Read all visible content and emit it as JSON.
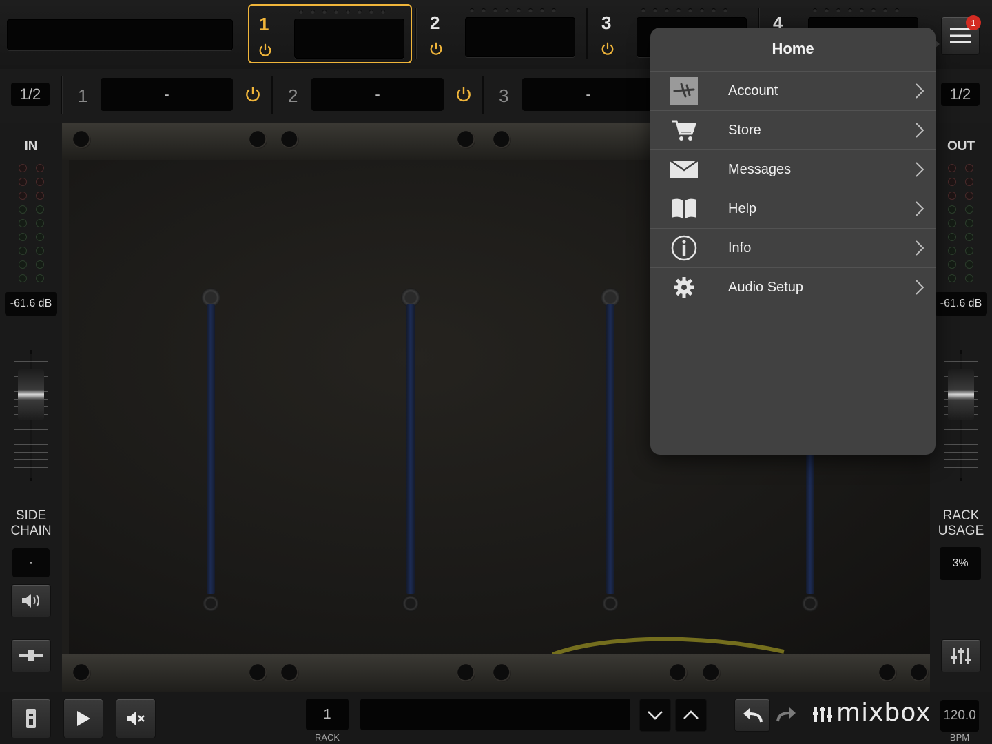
{
  "top_slots": [
    {
      "num": "1",
      "active": true
    },
    {
      "num": "2",
      "active": false
    },
    {
      "num": "3",
      "active": false
    },
    {
      "num": "4",
      "active": false
    }
  ],
  "channel_bar": {
    "page_left": "1/2",
    "page_right": "1/2",
    "channels": [
      {
        "num": "1",
        "value": "-"
      },
      {
        "num": "2",
        "value": "-"
      },
      {
        "num": "3",
        "value": "-"
      }
    ]
  },
  "input_panel": {
    "label": "IN",
    "level": "-61.6 dB",
    "side_chain_line1": "SIDE",
    "side_chain_line2": "CHAIN",
    "side_chain_value": "-"
  },
  "output_panel": {
    "label": "OUT",
    "level": "-61.6 dB",
    "rack_usage_line1": "RACK",
    "rack_usage_line2": "USAGE",
    "rack_usage_value": "3%"
  },
  "menu_button": {
    "badge": "1"
  },
  "home_menu": {
    "title": "Home",
    "items": [
      {
        "label": "Account",
        "icon": "account-icon"
      },
      {
        "label": "Store",
        "icon": "cart-icon"
      },
      {
        "label": "Messages",
        "icon": "envelope-icon"
      },
      {
        "label": "Help",
        "icon": "book-icon"
      },
      {
        "label": "Info",
        "icon": "info-icon"
      },
      {
        "label": "Audio Setup",
        "icon": "gear-icon"
      }
    ]
  },
  "bottom_bar": {
    "rack_number": "1",
    "rack_label": "RACK",
    "preset_name": "",
    "brand": "mixbox",
    "bpm": "120.0",
    "bpm_label": "BPM"
  },
  "colors": {
    "accent": "#f0b53a",
    "menu_bg": "#414141",
    "badge": "#d42b22"
  }
}
